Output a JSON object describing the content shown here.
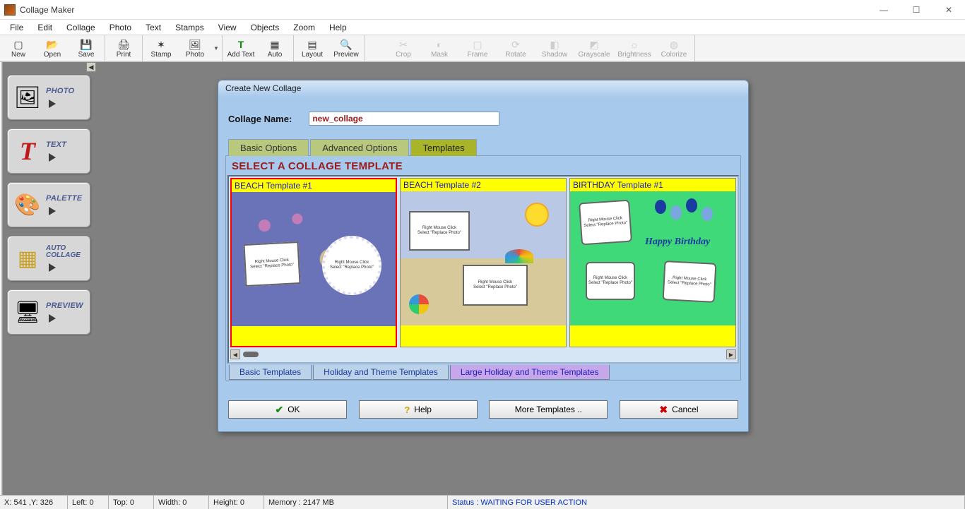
{
  "app": {
    "title": "Collage Maker"
  },
  "menu": [
    "File",
    "Edit",
    "Collage",
    "Photo",
    "Text",
    "Stamps",
    "View",
    "Objects",
    "Zoom",
    "Help"
  ],
  "toolbar": {
    "main": [
      {
        "label": "New",
        "icon": "▢"
      },
      {
        "label": "Open",
        "icon": "📂"
      },
      {
        "label": "Save",
        "icon": "💾"
      },
      {
        "label": "Print",
        "icon": "🖨"
      },
      {
        "label": "Stamp",
        "icon": "✶"
      },
      {
        "label": "Photo",
        "icon": "🖼"
      },
      {
        "label": "Add Text",
        "icon": "T"
      },
      {
        "label": "Auto",
        "icon": "▦"
      },
      {
        "label": "Layout",
        "icon": "▤"
      },
      {
        "label": "Preview",
        "icon": "🔍"
      }
    ],
    "edit": [
      {
        "label": "Crop",
        "icon": "✂"
      },
      {
        "label": "Mask",
        "icon": "◐"
      },
      {
        "label": "Frame",
        "icon": "▢"
      },
      {
        "label": "Rotate",
        "icon": "⟳"
      },
      {
        "label": "Shadow",
        "icon": "◧"
      },
      {
        "label": "Grayscale",
        "icon": "◩"
      },
      {
        "label": "Brightness",
        "icon": "☼"
      },
      {
        "label": "Colorize",
        "icon": "◍"
      }
    ]
  },
  "side": [
    {
      "label": "PHOTO",
      "icon": "🖼"
    },
    {
      "label": "TEXT",
      "icon": "T",
      "iconColor": "#c01818",
      "iconFont": "serif",
      "iconStyle": "italic"
    },
    {
      "label": "PALETTE",
      "icon": "🎨"
    },
    {
      "label": "AUTO",
      "label2": "COLLAGE",
      "icon": "▦",
      "iconColor": "#c9a227"
    },
    {
      "label": "PREVIEW",
      "icon": "🖥",
      "iconColor": "#c9a227"
    }
  ],
  "dialog": {
    "title": "Create New Collage",
    "name_label": "Collage Name:",
    "name_value": "new_collage",
    "tabs": [
      "Basic Options",
      "Advanced Options",
      "Templates"
    ],
    "active_tab": 2,
    "select_header": "SELECT A COLLAGE TEMPLATE",
    "templates": [
      {
        "name": "BEACH Template #1",
        "selected": true
      },
      {
        "name": "BEACH Template #2",
        "selected": false
      },
      {
        "name": "BIRTHDAY Template #1",
        "selected": false
      }
    ],
    "placeholder_text_1": "Right Mouse Click",
    "placeholder_text_2": "Select \"Replace Photo\"",
    "happy_birthday": "Happy Birthday",
    "bottom_tabs": [
      "Basic Templates",
      "Holiday and Theme Templates",
      "Large Holiday and Theme Templates"
    ],
    "bottom_tab_selected": 2,
    "buttons": {
      "ok": "OK",
      "help": "Help",
      "more": "More Templates ..",
      "cancel": "Cancel"
    }
  },
  "status": {
    "coords": "X: 541 ,Y: 326",
    "left": "Left: 0",
    "top": "Top: 0",
    "width": "Width: 0",
    "height": "Height: 0",
    "memory": "Memory : 2147 MB",
    "state": "Status : WAITING FOR USER ACTION"
  }
}
